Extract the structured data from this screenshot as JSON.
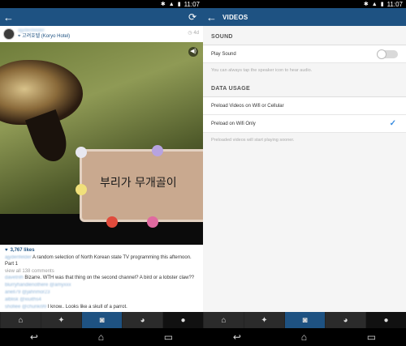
{
  "status_bar": {
    "time": "11:07"
  },
  "feed": {
    "post": {
      "username": "ajydenfelder",
      "location": "고려호텔 (Koryo Hotel)",
      "age": "4d",
      "video_caption": "부리가 무개골이",
      "likes": "3,767 likes",
      "caption_user": "ajydenfelder",
      "caption": "A random selection of North Korean state TV programming this afternoon. Part 1",
      "view_all": "view all 138 comments",
      "comments": [
        {
          "user": "davetrilh",
          "text": "Bizarre. WTH was that thing on the second channel? A bird or a lobster claw??"
        },
        {
          "user": "blurryhandlenothere @amyxxx",
          "text": ""
        },
        {
          "user": "ariell79 @jahnmor23",
          "text": ""
        },
        {
          "user": "alblisk @xiuiths4",
          "text": ""
        },
        {
          "user": "shofiee @chunki99",
          "text": "I know.. Looks like a skull of a parrot."
        }
      ]
    }
  },
  "settings": {
    "title": "VIDEOS",
    "sound": {
      "header": "SOUND",
      "play_sound_label": "Play Sound",
      "play_sound_on": false,
      "hint": "You can always tap the speaker icon to hear audio."
    },
    "data_usage": {
      "header": "DATA USAGE",
      "option1": "Preload Videos on Wifi or Cellular",
      "option2": "Preload on Wifi Only",
      "selected": "Preload on Wifi Only",
      "hint": "Preloaded videos will start playing sooner."
    }
  },
  "nav": {
    "items": [
      "home-icon",
      "explore-icon",
      "camera-icon",
      "activity-icon",
      "profile-icon"
    ],
    "active_left": "camera-icon",
    "accent": "#1e5282"
  }
}
